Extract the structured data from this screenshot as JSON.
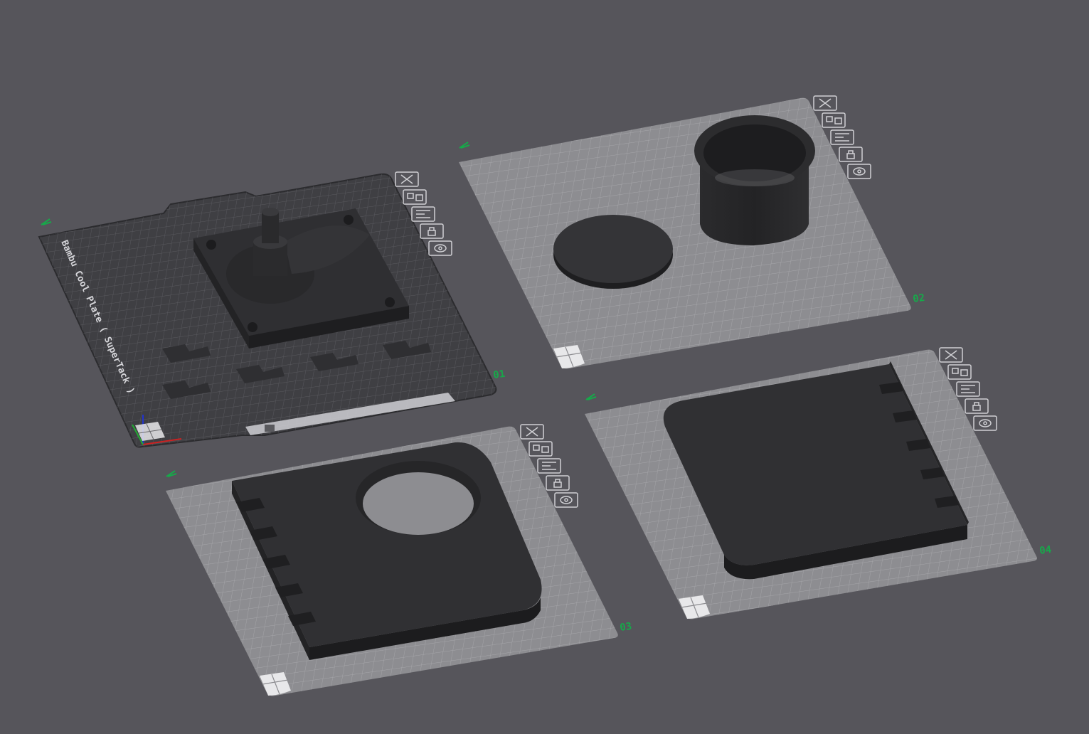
{
  "colors": {
    "background": "#56555b",
    "plate_light": "#8d8d91",
    "plate_grid": "#a6a6aa",
    "plate_dark": "#3f3f43",
    "model": "#2e2e30",
    "label_green": "#17a84a",
    "toolbar_stroke": "#d0d0d4"
  },
  "plates": [
    {
      "number": "01",
      "label": "Bambu Cool Plate ( SuperTack )",
      "toolbar": [
        "close-icon",
        "auto-arrange-icon",
        "plate-settings-icon",
        "lock-icon",
        "view-icon"
      ]
    },
    {
      "number": "02",
      "toolbar": [
        "close-icon",
        "auto-arrange-icon",
        "plate-settings-icon",
        "lock-icon",
        "view-icon"
      ]
    },
    {
      "number": "03",
      "toolbar": [
        "close-icon",
        "auto-arrange-icon",
        "plate-settings-icon",
        "lock-icon",
        "view-icon"
      ]
    },
    {
      "number": "04",
      "toolbar": [
        "close-icon",
        "auto-arrange-icon",
        "plate-settings-icon",
        "lock-icon",
        "view-icon"
      ]
    }
  ]
}
